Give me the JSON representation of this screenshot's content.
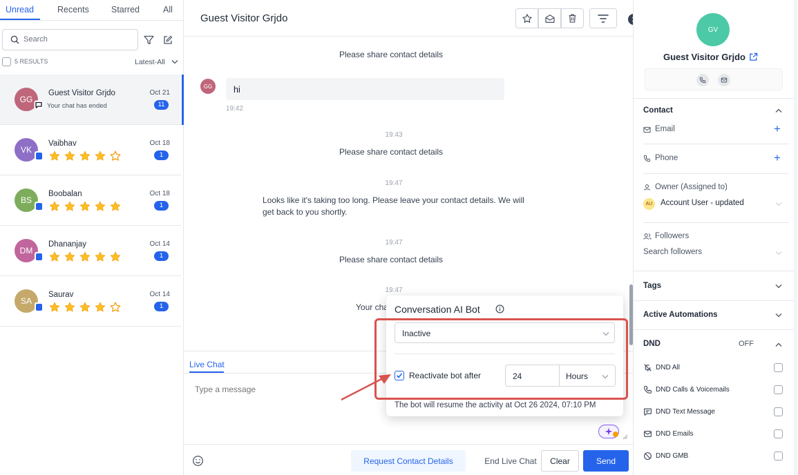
{
  "left": {
    "tabs": [
      "Unread",
      "Recents",
      "Starred",
      "All"
    ],
    "search_placeholder": "Search",
    "results": "5 RESULTS",
    "sort": "Latest-All",
    "conversations": [
      {
        "initials": "GG",
        "name": "Guest Visitor Grjdo",
        "preview": "Your chat has ended",
        "date": "Oct 21",
        "count": "11",
        "rating": 0,
        "color": "#c0667a"
      },
      {
        "initials": "VK",
        "name": "Vaibhav",
        "preview": "",
        "date": "Oct 18",
        "count": "1",
        "rating": 4,
        "color": "#8e6fc7"
      },
      {
        "initials": "BS",
        "name": "Boobalan",
        "preview": "",
        "date": "Oct 18",
        "count": "1",
        "rating": 5,
        "color": "#7dad5c"
      },
      {
        "initials": "DM",
        "name": "Dhananjay",
        "preview": "",
        "date": "Oct 14",
        "count": "1",
        "rating": 5,
        "color": "#c0669c"
      },
      {
        "initials": "SA",
        "name": "Saurav",
        "preview": "",
        "date": "Oct 14",
        "count": "1",
        "rating": 4,
        "color": "#c4a96a"
      }
    ]
  },
  "center": {
    "title": "Guest Visitor Grjdo",
    "messages": {
      "m1": "Please share contact details",
      "bubble_initials": "GG",
      "bubble_text": "hi",
      "bubble_time": "19:42",
      "t2": "19:43",
      "m2": "Please share contact details",
      "t3": "19:47",
      "m3": "Looks like it's taking too long. Please leave your contact details. We will get back to you shortly.",
      "t4": "19:47",
      "m4": "Please share contact details",
      "t5": "19:47",
      "m5": "Your cha"
    },
    "composer_tab": "Live Chat",
    "composer_placeholder": "Type a message",
    "buttons": {
      "request": "Request Contact Details",
      "end": "End Live Chat",
      "clear": "Clear",
      "send": "Send"
    }
  },
  "popup": {
    "title": "Conversation AI Bot",
    "status": "Inactive",
    "reactivate_label": "Reactivate bot after",
    "duration_value": "24",
    "duration_unit": "Hours",
    "resume_note": "The bot will resume the activity at Oct 26 2024, 07:10 PM"
  },
  "right": {
    "avatar_initials": "GV",
    "name": "Guest Visitor Grjdo",
    "contact_header": "Contact",
    "email_label": "Email",
    "phone_label": "Phone",
    "owner_label": "Owner (Assigned to)",
    "owner_initials": "AU",
    "owner_value": "Account User - updated",
    "followers_label": "Followers",
    "followers_placeholder": "Search followers",
    "tags_header": "Tags",
    "automations_header": "Active Automations",
    "dnd_header": "DND",
    "dnd_state": "OFF",
    "dnd_items": [
      "DND All",
      "DND Calls & Voicemails",
      "DND Text Message",
      "DND Emails",
      "DND GMB"
    ]
  }
}
